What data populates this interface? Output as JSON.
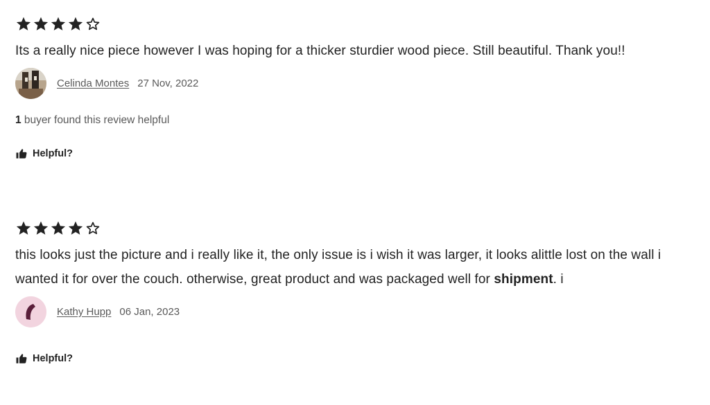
{
  "reviews": [
    {
      "rating": 4,
      "max_rating": 5,
      "text": "Its a really nice piece however I was hoping for a thicker sturdier wood piece. Still beautiful. Thank you!!",
      "reviewer": "Celinda Montes",
      "date": "27 Nov, 2022",
      "helpful_count": "1",
      "helpful_count_text": " buyer found this review helpful",
      "helpful_label": "Helpful?",
      "avatar_icon": "photo-avatar"
    },
    {
      "rating": 4,
      "max_rating": 5,
      "text_main": "this looks just the picture and i really like it, the only issue is i wish it was larger, it looks alittle lost on the wall i wanted it for over the couch. otherwise, great product and was packaged well for ",
      "text_bold": "shipment",
      "text_tail": ". i",
      "reviewer": "Kathy Hupp",
      "date": "06 Jan, 2023",
      "helpful_label": "Helpful?",
      "avatar_icon": "default-avatar",
      "avatar_bg": "#f2d4df",
      "avatar_fg": "#5a1f3a"
    }
  ],
  "colors": {
    "text": "#222222",
    "muted": "#595959",
    "star": "#222222"
  },
  "icons": {
    "star_filled": "star-filled-icon",
    "star_empty": "star-outline-icon",
    "helpful": "thumbs-up-icon"
  }
}
